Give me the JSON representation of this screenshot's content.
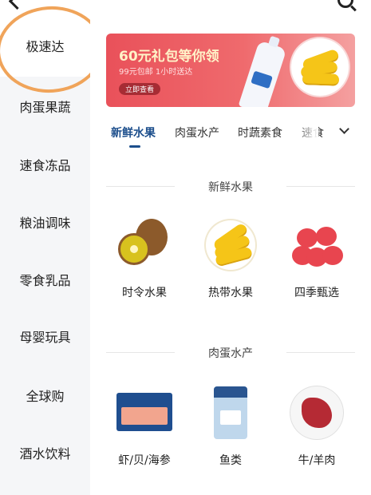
{
  "sidebar": {
    "items": [
      {
        "label": "极速达",
        "active": true
      },
      {
        "label": "肉蛋果蔬"
      },
      {
        "label": "速食冻品"
      },
      {
        "label": "粮油调味"
      },
      {
        "label": "零食乳品"
      },
      {
        "label": "母婴玩具"
      },
      {
        "label": "全球购"
      },
      {
        "label": "酒水饮料"
      }
    ]
  },
  "banner": {
    "title": "60元礼包等你领",
    "subtitle": "99元包邮 1小时送达",
    "cta": "立即查看"
  },
  "tabs": {
    "items": [
      "新鲜水果",
      "肉蛋水产",
      "时蔬素食",
      "速食"
    ],
    "active": 0,
    "expand_icon": "chevron-down-icon"
  },
  "sections": [
    {
      "title": "新鲜水果",
      "items": [
        {
          "label": "时令水果",
          "icon": "kiwi-image"
        },
        {
          "label": "热带水果",
          "icon": "banana-image"
        },
        {
          "label": "四季甄选",
          "icon": "apple-image"
        }
      ]
    },
    {
      "title": "肉蛋水产",
      "items": [
        {
          "label": "虾/贝/海参",
          "icon": "shrimp-box-image"
        },
        {
          "label": "鱼类",
          "icon": "fish-bag-image"
        },
        {
          "label": "牛/羊肉",
          "icon": "meat-plate-image"
        }
      ]
    }
  ],
  "colors": {
    "accent": "#1c4e8c",
    "banner_red": "#e9515a",
    "annotation_orange": "#f0a45a",
    "sidebar_bg": "#f5f6f8"
  }
}
